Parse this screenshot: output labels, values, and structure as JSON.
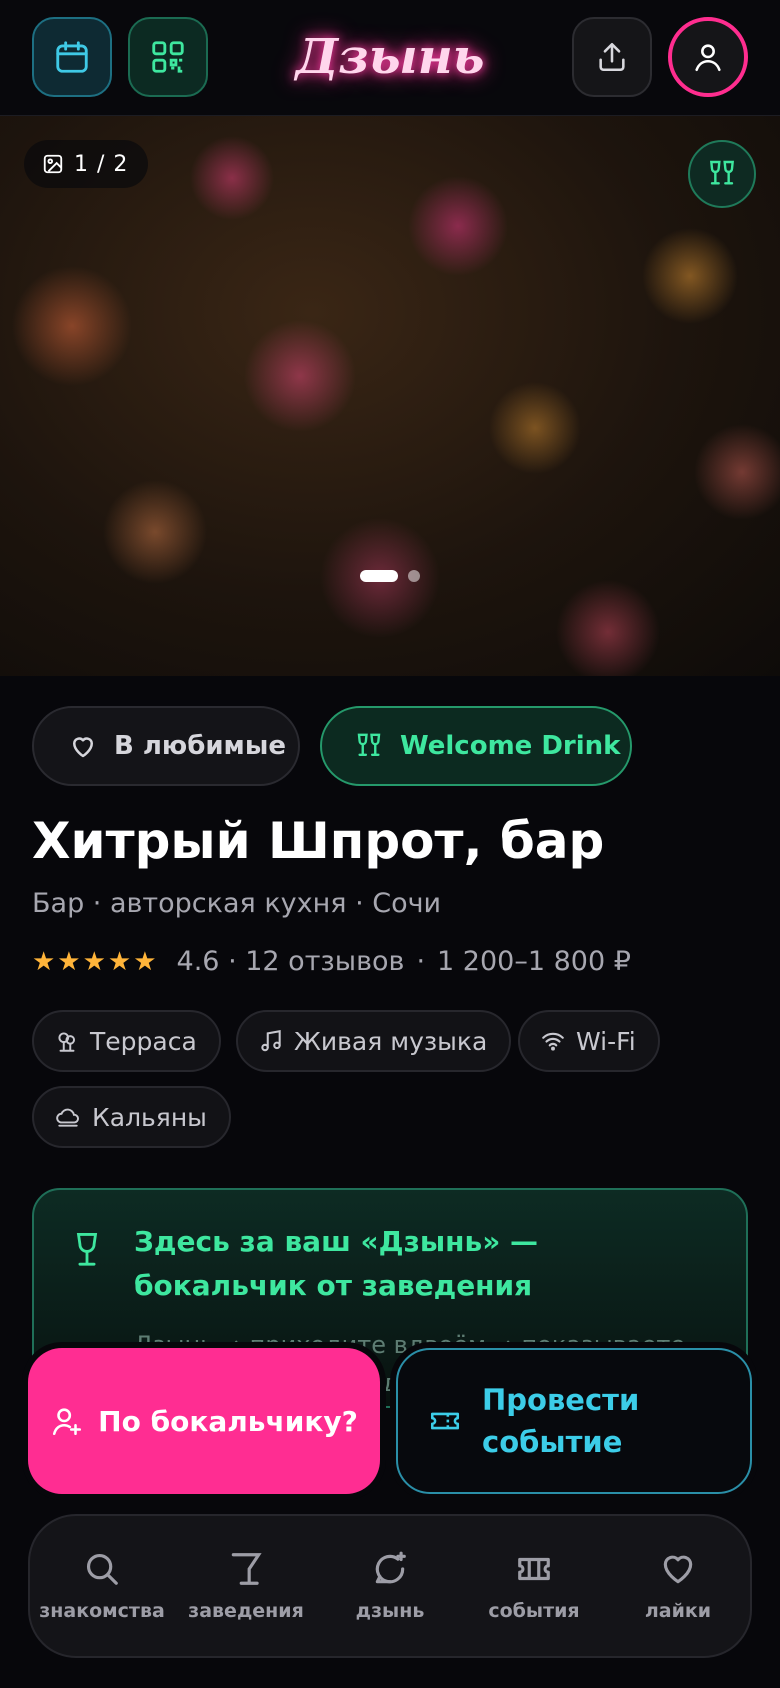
{
  "header": {
    "logo": "Дзынь",
    "calendar_icon": "calendar-icon",
    "qr_icon": "qr-code-icon",
    "share_icon": "share-icon",
    "profile_icon": "user-icon"
  },
  "hero": {
    "counter": "1 / 2",
    "image_icon": "image-icon",
    "badge_icon": "wine-glasses-icon",
    "slides_total": 2,
    "slide_active": 1
  },
  "actions": {
    "favorite_label": "В любимые",
    "welcome_drink_label": "Welcome Drink"
  },
  "venue": {
    "name": "Хитрый Шпрот, бар",
    "subtitle": "Бар · авторская кухня · Сочи",
    "stars": "★★★★★",
    "rating_text": "4.6 · 12 отзывов",
    "dot": "·",
    "price": "1 200–1 800 ₽",
    "rating_value": 4.6
  },
  "tags": [
    {
      "label": "Терраса",
      "icon": "tree-icon"
    },
    {
      "label": "Живая музыка",
      "icon": "music-note-icon"
    },
    {
      "label": "Wi-Fi",
      "icon": "wifi-icon"
    },
    {
      "label": "Кальяны",
      "icon": "hookah-cloud-icon"
    }
  ],
  "promo": {
    "title": "Здесь за ваш «Дзынь» — бокальчик от заведения",
    "text": "Дзынь → приходите вдвоём → показываете Welcome Drink. Без доплат и"
  },
  "cta": {
    "primary_label": "По бокальчику?",
    "secondary_label": "Провести событие"
  },
  "nav": [
    {
      "label": "знакомства",
      "icon": "search-icon"
    },
    {
      "label": "заведения",
      "icon": "cocktail-glass-icon"
    },
    {
      "label": "дзынь",
      "icon": "chat-sparkle-icon"
    },
    {
      "label": "события",
      "icon": "ticket-icon"
    },
    {
      "label": "лайки",
      "icon": "heart-icon"
    }
  ],
  "colors": {
    "accent_pink": "#ff2d92",
    "accent_green": "#3ee79f",
    "accent_cyan": "#3ccde8",
    "background": "#07070b"
  }
}
